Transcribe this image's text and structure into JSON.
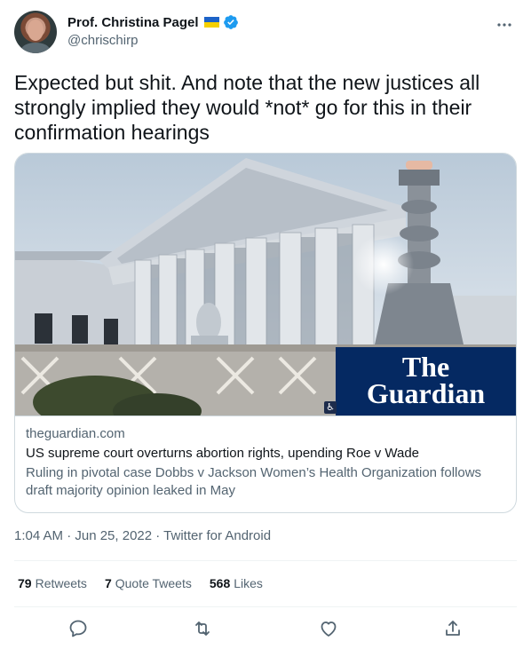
{
  "author": {
    "name": "Prof. Christina Pagel",
    "handle": "@chrischirp",
    "flag_colors": [
      "#1d63c8",
      "#f5d000"
    ],
    "verified_color": "#1d9bf0"
  },
  "tweet": {
    "text": "Expected but shit. And note that the new justices all strongly implied they would *not* go for this in their confirmation hearings"
  },
  "card": {
    "image_logo_line1": "The",
    "image_logo_line2": "Guardian",
    "domain": "theguardian.com",
    "title": "US supreme court overturns abortion rights, upending Roe v Wade",
    "description": "Ruling in pivotal case Dobbs v Jackson Women’s Health Organization follows draft majority opinion leaked in May"
  },
  "meta": {
    "timestamp": "1:04 AM · Jun 25, 2022 · Twitter for Android"
  },
  "stats": {
    "retweets_count": "79",
    "retweets_label": "Retweets",
    "quotes_count": "7",
    "quotes_label": "Quote Tweets",
    "likes_count": "568",
    "likes_label": "Likes"
  },
  "icons": {
    "more": "more-icon",
    "reply": "reply-icon",
    "retweet": "retweet-icon",
    "like": "heart-icon",
    "share": "share-icon"
  }
}
